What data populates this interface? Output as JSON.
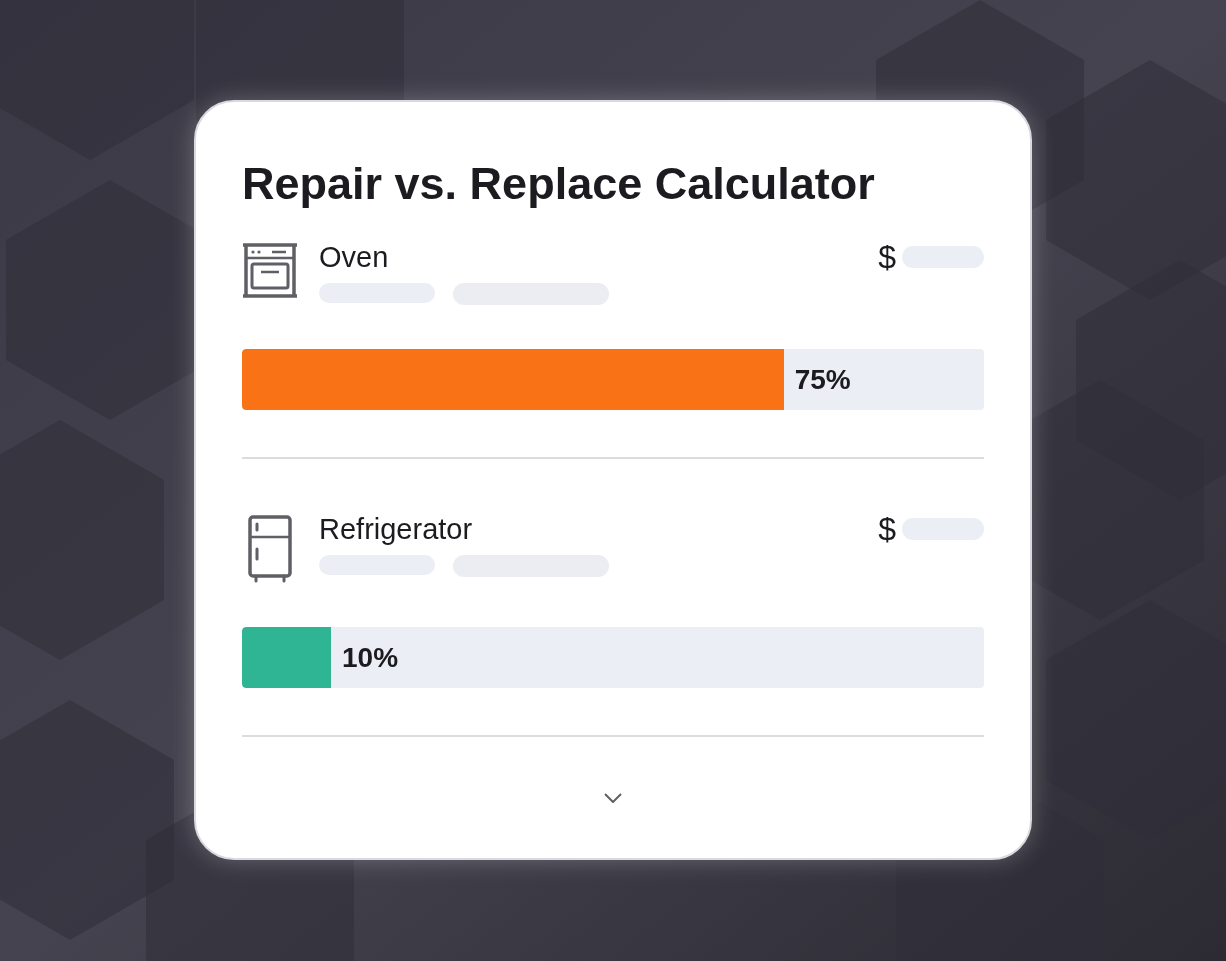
{
  "title": "Repair vs. Replace Calculator",
  "appliances": [
    {
      "kind": "oven",
      "name": "Oven",
      "currency": "$",
      "level": 0.73,
      "reading": "75%",
      "color": "#f97316"
    },
    {
      "kind": "refrigerator",
      "name": "Refrigerator",
      "currency": "$",
      "level": 0.12,
      "reading": "10%",
      "color": "#2fb594"
    }
  ]
}
